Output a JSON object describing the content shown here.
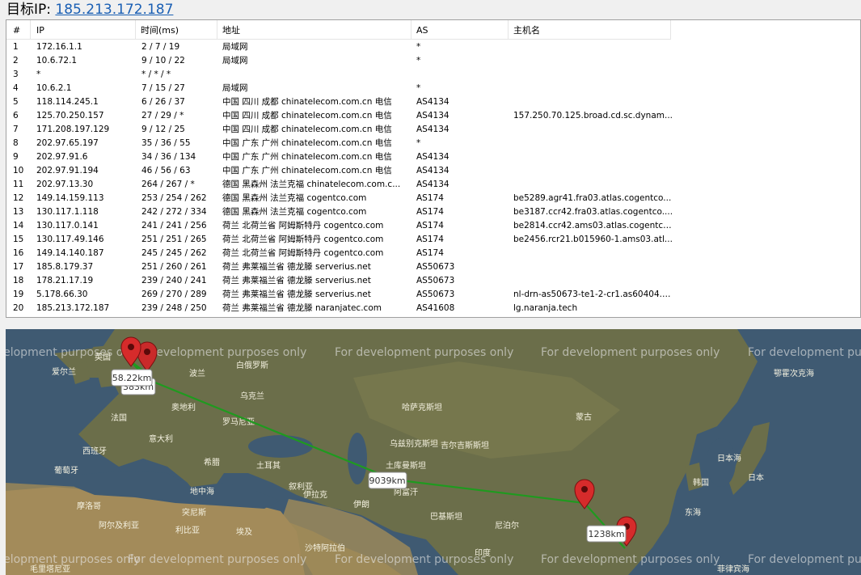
{
  "header": {
    "label": "目标IP: ",
    "ip": "185.213.172.187"
  },
  "columns": [
    "#",
    "IP",
    "时间(ms)",
    "地址",
    "AS",
    "主机名"
  ],
  "rows": [
    [
      "1",
      "172.16.1.1",
      "2 / 7 / 19",
      "局域网",
      "*",
      ""
    ],
    [
      "2",
      "10.6.72.1",
      "9 / 10 / 22",
      "局域网",
      "*",
      ""
    ],
    [
      "3",
      "*",
      "* / * / *",
      "",
      "",
      ""
    ],
    [
      "4",
      "10.6.2.1",
      "7 / 15 / 27",
      "局域网",
      "*",
      ""
    ],
    [
      "5",
      "118.114.245.1",
      "6 / 26 / 37",
      "中国 四川 成都 chinatelecom.com.cn 电信",
      "AS4134",
      ""
    ],
    [
      "6",
      "125.70.250.157",
      "27 / 29 / *",
      "中国 四川 成都 chinatelecom.com.cn 电信",
      "AS4134",
      "157.250.70.125.broad.cd.sc.dynam..."
    ],
    [
      "7",
      "171.208.197.129",
      "9 / 12 / 25",
      "中国 四川 成都 chinatelecom.com.cn 电信",
      "AS4134",
      ""
    ],
    [
      "8",
      "202.97.65.197",
      "35 / 36 / 55",
      "中国 广东 广州 chinatelecom.com.cn 电信",
      "*",
      ""
    ],
    [
      "9",
      "202.97.91.6",
      "34 / 36 / 134",
      "中国 广东 广州 chinatelecom.com.cn 电信",
      "AS4134",
      ""
    ],
    [
      "10",
      "202.97.91.194",
      "46 / 56 / 63",
      "中国 广东 广州 chinatelecom.com.cn 电信",
      "AS4134",
      ""
    ],
    [
      "11",
      "202.97.13.30",
      "264 / 267 / *",
      "德国 黑森州 法兰克福 chinatelecom.com.c...",
      "AS4134",
      ""
    ],
    [
      "12",
      "149.14.159.113",
      "253 / 254 / 262",
      "德国 黑森州 法兰克福 cogentco.com",
      "AS174",
      "be5289.agr41.fra03.atlas.cogentco..."
    ],
    [
      "13",
      "130.117.1.118",
      "242 / 272 / 334",
      "德国 黑森州 法兰克福 cogentco.com",
      "AS174",
      "be3187.ccr42.fra03.atlas.cogentco...."
    ],
    [
      "14",
      "130.117.0.141",
      "241 / 241 / 256",
      "荷兰 北荷兰省 阿姆斯特丹 cogentco.com",
      "AS174",
      "be2814.ccr42.ams03.atlas.cogentco..."
    ],
    [
      "15",
      "130.117.49.146",
      "251 / 251 / 265",
      "荷兰 北荷兰省 阿姆斯特丹 cogentco.com",
      "AS174",
      "be2456.rcr21.b015960-1.ams03.atl..."
    ],
    [
      "16",
      "149.14.140.187",
      "245 / 245 / 262",
      "荷兰 北荷兰省 阿姆斯特丹 cogentco.com",
      "AS174",
      ""
    ],
    [
      "17",
      "185.8.179.37",
      "251 / 260 / 261",
      "荷兰 弗莱福兰省 德龙滕 serverius.net",
      "AS50673",
      ""
    ],
    [
      "18",
      "178.21.17.19",
      "239 / 240 / 241",
      "荷兰 弗莱福兰省 德龙滕 serverius.net",
      "AS50673",
      ""
    ],
    [
      "19",
      "5.178.66.30",
      "269 / 270 / 289",
      "荷兰 弗莱福兰省 德龙滕 serverius.net",
      "AS50673",
      "nl-drn-as50673-te1-2-cr1.as60404.net"
    ],
    [
      "20",
      "185.213.172.187",
      "239 / 248 / 250",
      "荷兰 弗莱福兰省 德龙滕 naranjatec.com",
      "AS41608",
      "lg.naranja.tech"
    ]
  ],
  "map": {
    "watermark": "For development purposes only",
    "distances": [
      "58.22km",
      "383km",
      "9039km",
      "1238km"
    ],
    "labels": [
      "英国",
      "爱尔兰",
      "白俄罗斯",
      "波兰",
      "乌克兰",
      "法国",
      "罗马尼亚",
      "意大利",
      "西班牙",
      "葡萄牙",
      "希腊",
      "土耳其",
      "哈萨克斯坦",
      "蒙古",
      "乌兹别克斯坦",
      "吉尔吉斯斯坦",
      "土库曼斯坦",
      "伊朗",
      "伊拉克",
      "叙利亚",
      "阿富汗",
      "巴基斯坦",
      "突尼斯",
      "摩洛哥",
      "阿尔及利亚",
      "利比亚",
      "埃及",
      "沙特阿拉伯",
      "尼泊尔",
      "印度",
      "韩国",
      "日本",
      "日本海",
      "东海",
      "地中海",
      "鄂霍次克海",
      "毛里塔尼亚",
      "菲律宾海",
      "奥地利"
    ],
    "colors": {
      "route": "#1f9a1f",
      "marker": "#d62b2b",
      "water": "#3f5a72",
      "land": "#6b6d4a"
    }
  }
}
